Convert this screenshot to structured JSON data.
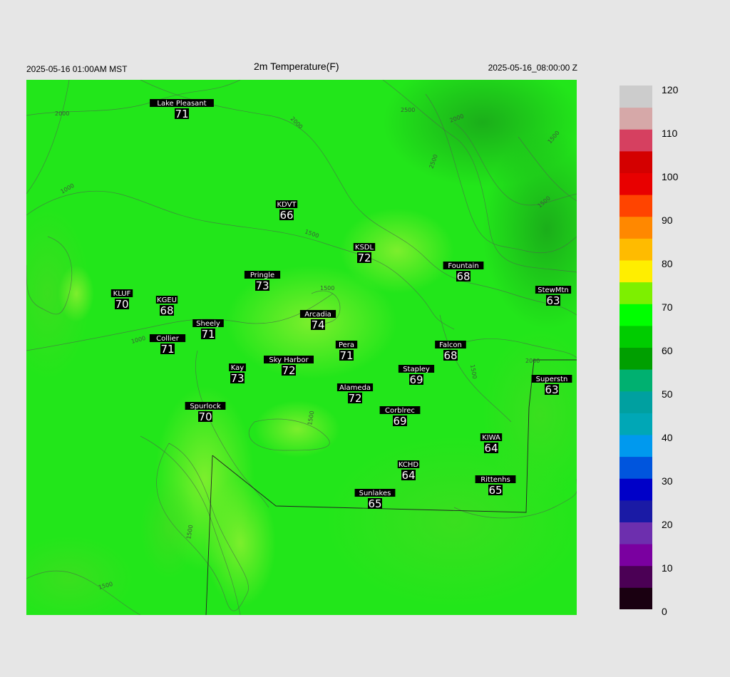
{
  "header": {
    "local_time": "2025-05-16 01:00AM MST",
    "title": "2m Temperature(F)",
    "utc_time": "2025-05-16_08:00:00 Z"
  },
  "stations": [
    {
      "name": "Lake Pleasant",
      "value": "71"
    },
    {
      "name": "KDVT",
      "value": "66"
    },
    {
      "name": "KSDL",
      "value": "72"
    },
    {
      "name": "Fountain",
      "value": "68"
    },
    {
      "name": "StewMtn",
      "value": "63"
    },
    {
      "name": "Pringle",
      "value": "73"
    },
    {
      "name": "KLUF",
      "value": "70"
    },
    {
      "name": "KGEU",
      "value": "68"
    },
    {
      "name": "Arcadia",
      "value": "74"
    },
    {
      "name": "Sheely",
      "value": "71"
    },
    {
      "name": "Collier",
      "value": "71"
    },
    {
      "name": "Pera",
      "value": "71"
    },
    {
      "name": "Falcon",
      "value": "68"
    },
    {
      "name": "Sky Harbor",
      "value": "72"
    },
    {
      "name": "Kay",
      "value": "73"
    },
    {
      "name": "Stapley",
      "value": "69"
    },
    {
      "name": "Superstn",
      "value": "63"
    },
    {
      "name": "Alameda",
      "value": "72"
    },
    {
      "name": "Spurlock",
      "value": "70"
    },
    {
      "name": "Corblrec",
      "value": "69"
    },
    {
      "name": "KIWA",
      "value": "64"
    },
    {
      "name": "KCHD",
      "value": "64"
    },
    {
      "name": "Rittenhs",
      "value": "65"
    },
    {
      "name": "Sunlakes",
      "value": "65"
    }
  ],
  "contour_labels": [
    "2000",
    "2000",
    "2500",
    "2000",
    "2500",
    "1500",
    "1500",
    "1500",
    "1000",
    "1000",
    "1500",
    "2000",
    "1500",
    "1500",
    "1500",
    "1500"
  ],
  "colorbar": {
    "ticks": [
      "120",
      "110",
      "100",
      "90",
      "80",
      "70",
      "60",
      "50",
      "40",
      "30",
      "20",
      "10",
      "0"
    ],
    "colors": [
      "#1a0011",
      "#4b0055",
      "#7a00a0",
      "#6d2fae",
      "#1a1aa5",
      "#0000c8",
      "#0055dd",
      "#0099ee",
      "#00a7b6",
      "#00a0a0",
      "#00b070",
      "#009f00",
      "#00cc00",
      "#00ff00",
      "#7df000",
      "#ffee00",
      "#ffbb00",
      "#ff8800",
      "#ff4400",
      "#e80000",
      "#d40000",
      "#d64060",
      "#d6a8a8",
      "#cccccc"
    ]
  }
}
